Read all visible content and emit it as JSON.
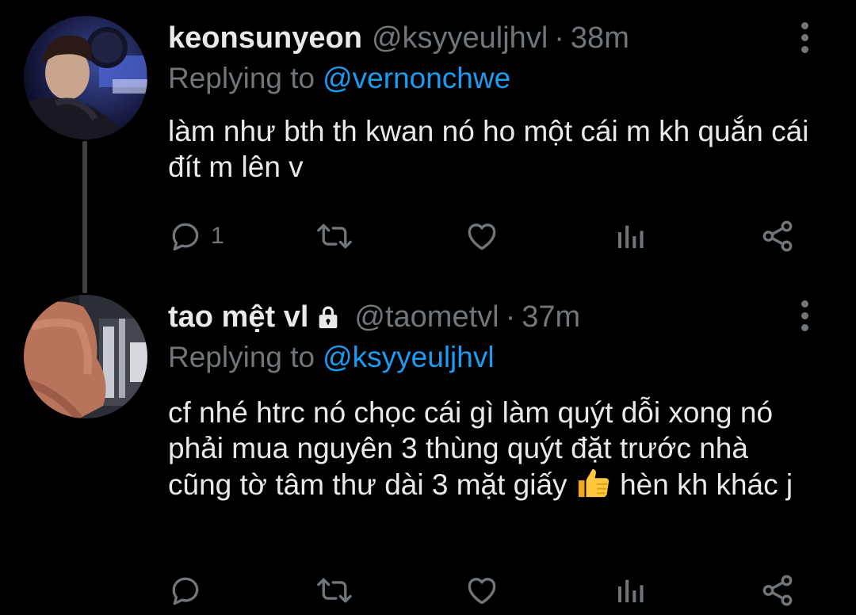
{
  "tweets": [
    {
      "name": "keonsunyeon",
      "handle": "@ksyyeuljhvl",
      "separator": "·",
      "time": "38m",
      "replying_prefix": "Replying to",
      "replying_to": "@vernonchwe",
      "text": "làm như bth th kwan nó ho một cái m kh quắn cái đít m lên v",
      "reply_count": "1",
      "locked": false
    },
    {
      "name": "tao mệt vl",
      "handle": "@taometvl",
      "separator": "·",
      "time": "37m",
      "replying_prefix": "Replying to",
      "replying_to": "@ksyyeuljhvl",
      "text_before_emoji": "cf nhé htrc nó chọc cái gì làm quýt dỗi xong nó phải mua nguyên 3 thùng quýt đặt trước nhà cũng tờ tâm thư dài 3 mặt giấy",
      "emoji": "thumbs-up",
      "text_after_emoji": "hèn kh khác j",
      "reply_count": "",
      "locked": true
    }
  ],
  "colors": {
    "background": "#000000",
    "primary_text": "#e7e9ea",
    "secondary_text": "#71767b",
    "accent": "#1d9bf0"
  },
  "icons": [
    "reply-icon",
    "retweet-icon",
    "like-icon",
    "analytics-icon",
    "share-icon",
    "lock-icon",
    "more-icon"
  ]
}
